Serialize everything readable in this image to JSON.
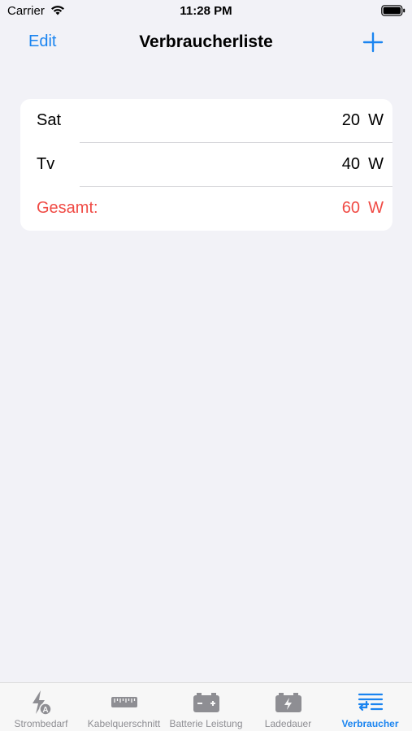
{
  "status_bar": {
    "carrier": "Carrier",
    "time": "11:28 PM"
  },
  "nav": {
    "edit_label": "Edit",
    "title": "Verbraucherliste",
    "add_icon": "plus-icon"
  },
  "list": {
    "items": [
      {
        "name": "Sat",
        "value": "20",
        "unit": "W"
      },
      {
        "name": "Tv",
        "value": "40",
        "unit": "W"
      }
    ],
    "total": {
      "label": "Gesamt:",
      "value": "60",
      "unit": "W"
    }
  },
  "tabs": [
    {
      "label": "Strombedarf",
      "icon": "bolt-a-icon",
      "active": false
    },
    {
      "label": "Kabelquerschnitt",
      "icon": "ruler-icon",
      "active": false
    },
    {
      "label": "Batterie Leistung",
      "icon": "battery-plus-minus-icon",
      "active": false
    },
    {
      "label": "Ladedauer",
      "icon": "battery-charge-icon",
      "active": false
    },
    {
      "label": "Verbraucher",
      "icon": "list-icon",
      "active": true
    }
  ],
  "colors": {
    "accent": "#1a84f0",
    "total_red": "#f04b45",
    "background": "#f2f2f7",
    "inactive_tab": "#8e8e93"
  }
}
